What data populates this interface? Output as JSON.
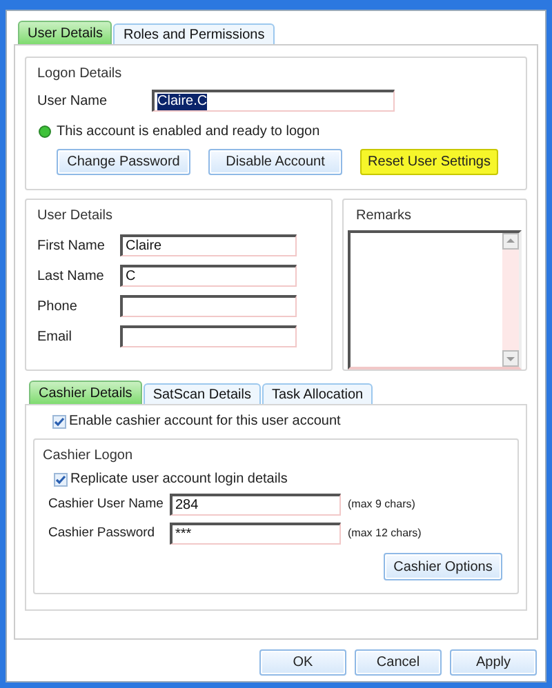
{
  "tabs": [
    {
      "label": "User Details",
      "selected": true
    },
    {
      "label": "Roles and Permissions",
      "selected": false
    }
  ],
  "logon_details": {
    "title": "Logon Details",
    "user_name": {
      "label": "User Name",
      "value": "Claire.C",
      "text_selected": true
    },
    "status": {
      "enabled": true,
      "text": "This account is enabled and ready to logon"
    },
    "buttons": [
      {
        "label": "Change Password",
        "highlighted": false
      },
      {
        "label": "Disable Account",
        "highlighted": false
      },
      {
        "label": "Reset User Settings",
        "highlighted": true
      }
    ]
  },
  "user_details": {
    "title": "User Details",
    "fields": [
      {
        "label": "First Name",
        "value": "Claire"
      },
      {
        "label": "Last Name",
        "value": "C"
      },
      {
        "label": "Phone"
      },
      {
        "label": "Email"
      }
    ]
  },
  "remarks": {
    "title": "Remarks"
  },
  "sub_tabs": [
    {
      "label": "Cashier Details",
      "selected": true
    },
    {
      "label": "SatScan Details",
      "selected": false
    },
    {
      "label": "Task Allocation",
      "selected": false
    }
  ],
  "cashier": {
    "enable": {
      "label": "Enable cashier account for this user account",
      "checked": true
    },
    "logon": {
      "title": "Cashier Logon",
      "replicate": {
        "label": "Replicate user account login details",
        "checked": true
      },
      "fields": [
        {
          "label": "Cashier User Name",
          "value": "284",
          "hint": "(max 9 chars)"
        },
        {
          "label": "Cashier Password",
          "value": "***",
          "hint": "(max 12 chars)"
        }
      ],
      "options_button": "Cashier Options"
    }
  },
  "dialog_buttons": [
    "OK",
    "Cancel",
    "Apply"
  ]
}
